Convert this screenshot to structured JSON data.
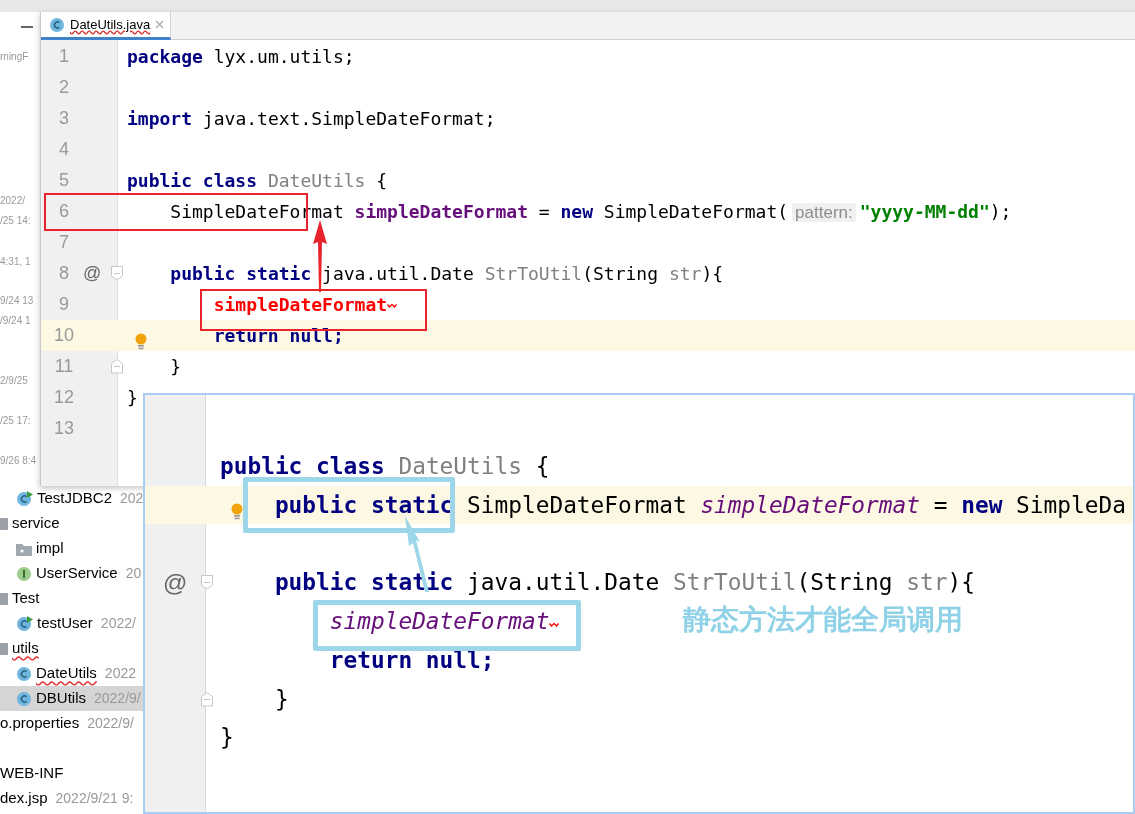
{
  "project_panel": {
    "clipped_dates": [
      "rningF",
      "2022/",
      "/25 14:",
      "4:31, 1",
      "9/24 13",
      "/9/24 1",
      "2/9/25",
      "/25 17:",
      "9/26 8:4"
    ],
    "tree": [
      {
        "label": "TestJDBC2",
        "date": "202",
        "kind": "test-class",
        "selected": false,
        "misspelled": false
      },
      {
        "label": "service",
        "kind": "package",
        "selected": false,
        "misspelled": false,
        "children": [
          {
            "label": "impl",
            "kind": "folder",
            "selected": false,
            "misspelled": false
          },
          {
            "label": "UserService",
            "date": "20",
            "kind": "interface",
            "selected": false,
            "misspelled": false
          }
        ]
      },
      {
        "label": "Test",
        "kind": "package",
        "selected": false,
        "misspelled": false,
        "children": [
          {
            "label": "testUser",
            "date": "2022/",
            "kind": "test-class",
            "selected": false,
            "misspelled": false
          }
        ]
      },
      {
        "label": "utils",
        "kind": "package",
        "selected": false,
        "misspelled": true,
        "children": [
          {
            "label": "DateUtils",
            "date": "2022",
            "kind": "class",
            "selected": false,
            "misspelled": true
          },
          {
            "label": "DBUtils",
            "date": "2022/9/",
            "kind": "class",
            "selected": true,
            "misspelled": false
          }
        ]
      },
      {
        "label": "o.properties",
        "date": "2022/9/",
        "kind": "file",
        "selected": false,
        "misspelled": false
      },
      {
        "label": "WEB-INF",
        "kind": "file",
        "selected": false,
        "misspelled": false
      },
      {
        "label": "dex.jsp",
        "date": "2022/9/21 9:",
        "kind": "file",
        "selected": false,
        "misspelled": false
      }
    ]
  },
  "editor": {
    "tabs": [
      {
        "label": "DateUtils.java",
        "selected": true,
        "misspelled": true
      }
    ],
    "lines": [
      {
        "number": "1",
        "kind": "top",
        "tokens": [
          {
            "kind": "keyword",
            "text": "package"
          },
          {
            "kind": "plain",
            "text": " lyx.um.utils;"
          }
        ]
      },
      {
        "number": "2",
        "kind": "blank"
      },
      {
        "number": "3",
        "kind": "top",
        "tokens": [
          {
            "kind": "keyword",
            "text": "import"
          },
          {
            "kind": "plain",
            "text": " java.text.SimpleDateFormat;"
          }
        ]
      },
      {
        "number": "4",
        "kind": "blank"
      },
      {
        "number": "5",
        "kind": "top",
        "tokens": [
          {
            "kind": "keyword",
            "text": "public class "
          },
          {
            "kind": "unused",
            "text": "DateUtils"
          },
          {
            "kind": "plain",
            "text": " {"
          }
        ]
      },
      {
        "number": "6",
        "kind": "member",
        "tokens": [
          {
            "kind": "plain",
            "text": "SimpleDateFormat "
          },
          {
            "kind": "field",
            "text": "simpleDateFormat"
          },
          {
            "kind": "plain",
            "text": " = "
          },
          {
            "kind": "keyword",
            "text": "new"
          },
          {
            "kind": "plain",
            "text": " SimpleDateFormat("
          },
          {
            "kind": "hint",
            "text": "pattern:"
          },
          {
            "kind": "string",
            "text": "\"yyyy-MM-dd\""
          },
          {
            "kind": "plain",
            "text": ");"
          }
        ]
      },
      {
        "number": "7",
        "kind": "blank"
      },
      {
        "number": "8",
        "kind": "member",
        "gutter_mark": "@",
        "fold_start": true,
        "tokens": [
          {
            "kind": "keyword",
            "text": "public static"
          },
          {
            "kind": "plain",
            "text": " java.util.Date "
          },
          {
            "kind": "unused",
            "text": "StrToUtil"
          },
          {
            "kind": "plain",
            "text": "(String "
          },
          {
            "kind": "param",
            "text": "str"
          },
          {
            "kind": "plain",
            "text": "){"
          }
        ]
      },
      {
        "number": "9",
        "kind": "body",
        "error_mark": true,
        "tokens": [
          {
            "kind": "unresolved",
            "text": "simpleDateFormat"
          }
        ]
      },
      {
        "number": "10",
        "kind": "body",
        "current": true,
        "bulb": true,
        "tokens": [
          {
            "kind": "keyword",
            "text": "return null;"
          }
        ]
      },
      {
        "number": "11",
        "kind": "member",
        "fold_end": true,
        "tokens": [
          {
            "kind": "plain",
            "text": "}"
          }
        ]
      },
      {
        "number": "12",
        "kind": "top",
        "tokens": [
          {
            "kind": "plain",
            "text": "}"
          }
        ]
      },
      {
        "number": "13",
        "kind": "blank"
      }
    ]
  },
  "overlay_editor": {
    "lines": [
      {
        "kind": "blank"
      },
      {
        "kind": "top",
        "tokens": [
          {
            "kind": "keyword",
            "text": "public class "
          },
          {
            "kind": "unused",
            "text": "DateUtils"
          },
          {
            "kind": "plain",
            "text": " {"
          }
        ]
      },
      {
        "kind": "member",
        "current": true,
        "bulb": true,
        "tokens": [
          {
            "kind": "keyword",
            "text": "public static"
          },
          {
            "kind": "plain",
            "text": " SimpleDateFormat "
          },
          {
            "kind": "static-field",
            "text": "simpleDateFormat"
          },
          {
            "kind": "plain",
            "text": " = "
          },
          {
            "kind": "keyword",
            "text": "new"
          },
          {
            "kind": "plain",
            "text": " SimpleDa"
          }
        ]
      },
      {
        "kind": "blank"
      },
      {
        "kind": "member",
        "gutter_mark": "@",
        "fold_start": true,
        "tokens": [
          {
            "kind": "keyword",
            "text": "public static"
          },
          {
            "kind": "plain",
            "text": " java.util.Date "
          },
          {
            "kind": "unused",
            "text": "StrToUtil"
          },
          {
            "kind": "plain",
            "text": "(String "
          },
          {
            "kind": "param",
            "text": "str"
          },
          {
            "kind": "plain",
            "text": "){"
          }
        ]
      },
      {
        "kind": "body",
        "error_mark": true,
        "tokens": [
          {
            "kind": "static-field",
            "text": "simpleDateFormat"
          }
        ]
      },
      {
        "kind": "body",
        "tokens": [
          {
            "kind": "keyword",
            "text": "return null;"
          }
        ]
      },
      {
        "kind": "member",
        "fold_end": true,
        "tokens": [
          {
            "kind": "plain",
            "text": "}"
          }
        ]
      },
      {
        "kind": "top",
        "tokens": [
          {
            "kind": "plain",
            "text": "}"
          }
        ]
      }
    ],
    "caption": "静态方法才能全局调用"
  }
}
